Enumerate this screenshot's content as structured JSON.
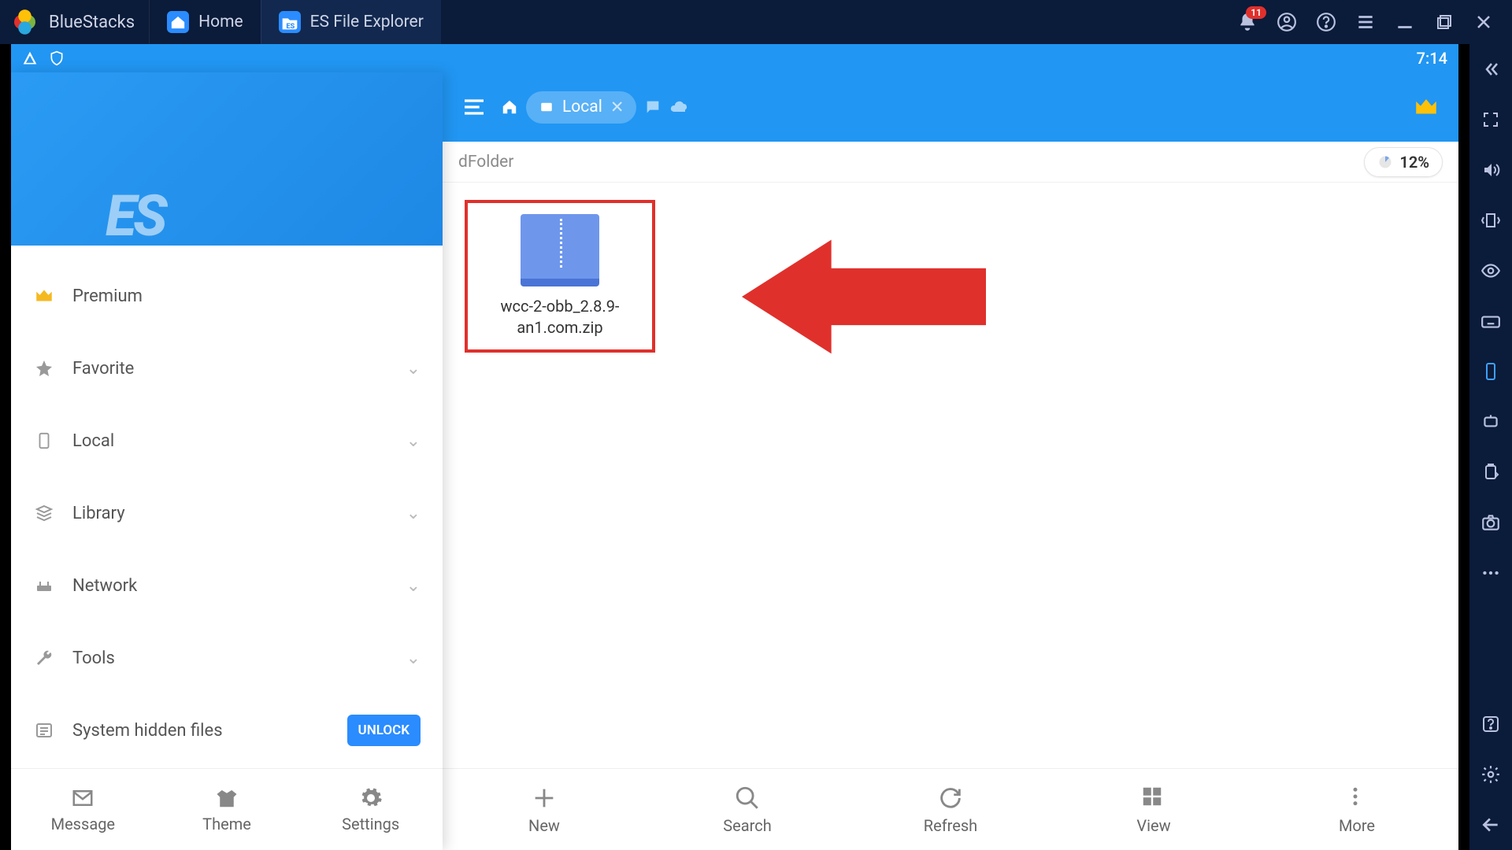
{
  "titlebar": {
    "brand": "BlueStacks",
    "tabs": [
      {
        "label": "Home"
      },
      {
        "label": "ES File Explorer"
      }
    ],
    "notification_count": "11"
  },
  "statusbar": {
    "time": "7:14"
  },
  "appbar": {
    "chip_label": "Local"
  },
  "pathrow": {
    "path_fragment": "dFolder",
    "storage_pct": "12%"
  },
  "sidebar": {
    "hero_logo": "ES",
    "items": [
      {
        "label": "Premium",
        "icon": "crown",
        "expandable": false
      },
      {
        "label": "Favorite",
        "icon": "star",
        "expandable": true
      },
      {
        "label": "Local",
        "icon": "phone",
        "expandable": true
      },
      {
        "label": "Library",
        "icon": "stack",
        "expandable": true
      },
      {
        "label": "Network",
        "icon": "router",
        "expandable": true
      },
      {
        "label": "Tools",
        "icon": "wrench",
        "expandable": true
      },
      {
        "label": "System hidden files",
        "icon": "list",
        "unlock": "UNLOCK"
      }
    ],
    "bottom": [
      {
        "label": "Message"
      },
      {
        "label": "Theme"
      },
      {
        "label": "Settings"
      }
    ]
  },
  "files": [
    {
      "name": "wcc-2-obb_2.8.9-an1.com.zip"
    }
  ],
  "bottombar": [
    {
      "label": "New"
    },
    {
      "label": "Search"
    },
    {
      "label": "Refresh"
    },
    {
      "label": "View"
    },
    {
      "label": "More"
    }
  ]
}
